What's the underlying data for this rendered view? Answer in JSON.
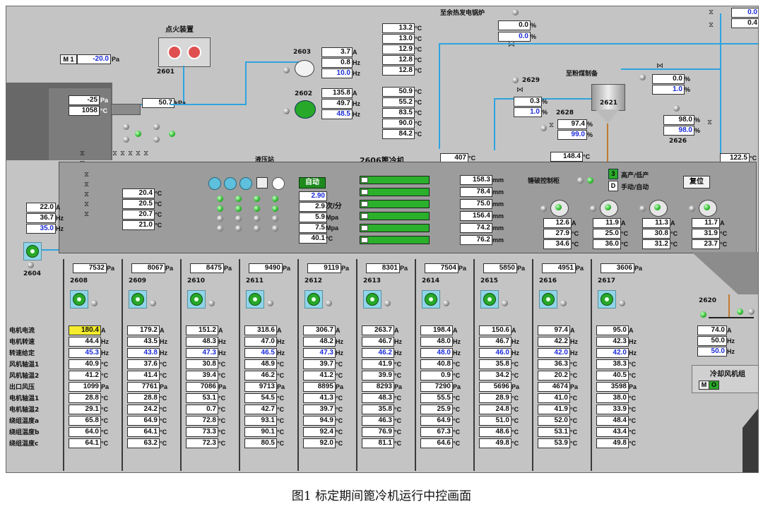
{
  "caption": "图1 标定期间篦冷机运行中控画面",
  "top": {
    "ignition_title": "点火装置",
    "ignition_tag": "2601",
    "m1": "M 1",
    "press1": "-20.0",
    "press1_unit": "Pa",
    "kiln_press": "-25",
    "kiln_press_unit": "Pa",
    "kiln_temp": "1058",
    "kiln_temp_unit": "°C",
    "kpa": "50.7",
    "kpa_unit": "kPa",
    "tag_2603": "2603",
    "f2603_a": "3.7",
    "f2603_hz": "0.8",
    "f2603_hz2": "10.0",
    "tag_2602": "2602",
    "f2602_a": "135.8",
    "f2602_hz": "49.7",
    "f2602_hz2": "48.5",
    "temps_right": [
      "13.2",
      "13.0",
      "12.9",
      "12.8",
      "12.8",
      "50.9",
      "55.2",
      "83.5",
      "90.0",
      "84.2"
    ],
    "waste_heat": "至余热发电锅炉",
    "wh_p1": "0.0",
    "wh_p2": "0.0",
    "coal_mill": "至粉煤制备",
    "v2629": "2629",
    "v2629_a": "0.3",
    "v2629_b": "1.0",
    "v2628": "2628",
    "v2628_a": "97.4",
    "v2628_b": "99.0",
    "silo": "2621",
    "silo_temp": "148.4",
    "cm_p1": "0.0",
    "cm_p2": "1.0",
    "v2626": "2626",
    "v2626_a": "98.0",
    "v2626_b": "98.0",
    "tr_a": "0.0",
    "tr_b": "0.4",
    "temp_1225": "122.5",
    "temp_407": "407"
  },
  "hyd": {
    "title": "液压站",
    "cooler_title": "2606篦冷机",
    "auto_btn": "自动",
    "spd_set": "2.90",
    "spd": "2.9",
    "spd_unit": "次/分",
    "mp1": "5.9",
    "mp2": "7.5",
    "mp_unit": "Mpa",
    "oil": "40.1",
    "temps": [
      "20.4",
      "20.5",
      "20.7",
      "21.0"
    ],
    "mm": [
      "158.3",
      "78.4",
      "75.0",
      "156.4",
      "74.2",
      "76.2"
    ],
    "mm_unit": "mm",
    "crusher": "锤破控制柜",
    "c3": "3",
    "cD": "D",
    "hilo": "高产/低产",
    "manauto": "手动/自动",
    "reset": "复位",
    "crushers": [
      {
        "a": "12.6",
        "t1": "27.9",
        "t2": "34.6"
      },
      {
        "a": "11.9",
        "t1": "25.0",
        "t2": "36.0"
      },
      {
        "a": "11.3",
        "t1": "30.8",
        "t2": "31.2"
      },
      {
        "a": "11.7",
        "t1": "31.9",
        "t2": "23.7"
      }
    ]
  },
  "f2604": {
    "tag": "2604",
    "a": "22.0",
    "hz": "36.7",
    "hz2": "35.0"
  },
  "units": {
    "A": "A",
    "Hz": "Hz",
    "C": "°C",
    "Pa": "Pa",
    "pct": "%"
  },
  "row_labels": [
    "电机电流",
    "电机转速",
    "转速给定",
    "风机轴温1",
    "风机轴温2",
    "出口风压",
    "电机轴温1",
    "电机轴温2",
    "绕组温度a",
    "绕组温度b",
    "绕组温度c"
  ],
  "row_units": [
    "A",
    "Hz",
    "Hz",
    "°C",
    "°C",
    "Pa",
    "°C",
    "°C",
    "°C",
    "°C",
    "°C"
  ],
  "fans": [
    {
      "tag": "2608",
      "p": "7532",
      "v": [
        "180.4",
        "44.4",
        "45.3",
        "40.9",
        "41.2",
        "1099",
        "28.8",
        "29.1",
        "65.8",
        "64.0",
        "64.1"
      ]
    },
    {
      "tag": "2609",
      "p": "8067",
      "v": [
        "179.2",
        "43.5",
        "43.8",
        "37.6",
        "41.4",
        "7761",
        "28.8",
        "24.2",
        "64.9",
        "64.1",
        "63.2"
      ]
    },
    {
      "tag": "2610",
      "p": "8475",
      "v": [
        "151.2",
        "48.3",
        "47.3",
        "30.8",
        "39.4",
        "7086",
        "53.1",
        "0.7",
        "72.8",
        "73.3",
        "72.3"
      ]
    },
    {
      "tag": "2611",
      "p": "9490",
      "v": [
        "318.6",
        "47.0",
        "46.5",
        "48.9",
        "46.2",
        "9713",
        "54.5",
        "42.7",
        "93.1",
        "90.1",
        "80.5"
      ]
    },
    {
      "tag": "2612",
      "p": "9119",
      "v": [
        "306.7",
        "48.2",
        "47.3",
        "39.7",
        "41.2",
        "8895",
        "41.3",
        "39.7",
        "94.9",
        "92.4",
        "92.0"
      ]
    },
    {
      "tag": "2613",
      "p": "8301",
      "v": [
        "263.7",
        "46.7",
        "46.2",
        "41.9",
        "39.9",
        "8293",
        "48.3",
        "35.8",
        "46.3",
        "76.9",
        "81.1"
      ]
    },
    {
      "tag": "2614",
      "p": "7504",
      "v": [
        "198.4",
        "48.0",
        "48.0",
        "40.8",
        "0.9",
        "7290",
        "55.5",
        "25.9",
        "64.9",
        "67.3",
        "64.6"
      ]
    },
    {
      "tag": "2615",
      "p": "5850",
      "v": [
        "150.6",
        "46.7",
        "46.0",
        "35.8",
        "34.2",
        "5696",
        "28.9",
        "24.8",
        "51.0",
        "48.6",
        "49.8"
      ]
    },
    {
      "tag": "2616",
      "p": "4951",
      "v": [
        "97.4",
        "42.2",
        "42.0",
        "36.3",
        "20.2",
        "4674",
        "41.0",
        "41.9",
        "52.0",
        "53.1",
        "53.9"
      ]
    },
    {
      "tag": "2617",
      "p": "3606",
      "v": [
        "95.0",
        "42.3",
        "42.0",
        "38.3",
        "40.5",
        "3598",
        "38.0",
        "33.9",
        "48.4",
        "43.4",
        "49.8"
      ]
    }
  ],
  "f2620": {
    "tag": "2620",
    "a": "74.0",
    "hz": "50.0",
    "hz2": "50.0",
    "group": "冷却风机组",
    "m": "M",
    "o": "O"
  }
}
